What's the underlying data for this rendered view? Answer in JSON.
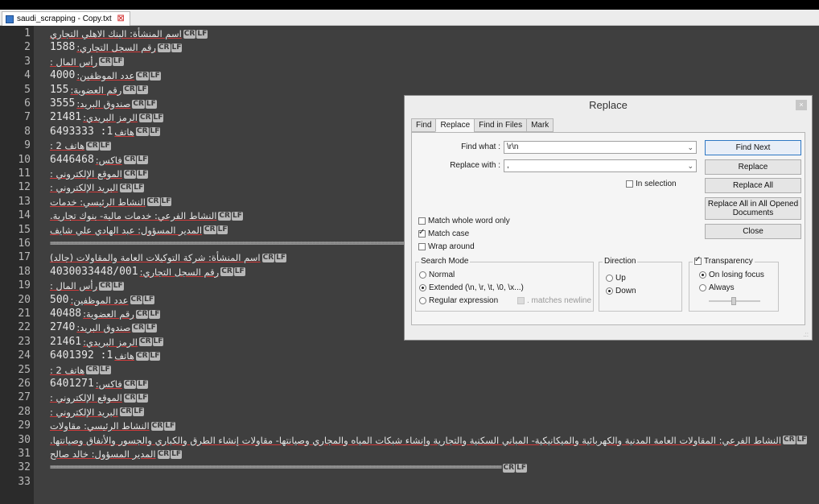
{
  "tab": {
    "filename": "saudi_scrapping - Copy.txt"
  },
  "lines": [
    {
      "num": "1",
      "segs": [
        {
          "t": "ar",
          "v": "اسم المنشأة: البنك الاهلي التجاري"
        },
        {
          "t": "crlf"
        }
      ]
    },
    {
      "num": "2",
      "segs": [
        {
          "t": "num",
          "v": "1588"
        },
        {
          "t": "ar",
          "v": "رقم السجل التجاري:"
        },
        {
          "t": "crlf"
        }
      ]
    },
    {
      "num": "3",
      "segs": [
        {
          "t": "ar",
          "v": "رأس المال :"
        },
        {
          "t": "crlf"
        }
      ]
    },
    {
      "num": "4",
      "segs": [
        {
          "t": "num",
          "v": "4000"
        },
        {
          "t": "ar",
          "v": "عدد الموظفين:"
        },
        {
          "t": "crlf"
        }
      ]
    },
    {
      "num": "5",
      "segs": [
        {
          "t": "num",
          "v": "155"
        },
        {
          "t": "ar",
          "v": "رقم العضوية:"
        },
        {
          "t": "crlf"
        }
      ]
    },
    {
      "num": "6",
      "segs": [
        {
          "t": "num",
          "v": "3555"
        },
        {
          "t": "ar",
          "v": "صندوق البريد:"
        },
        {
          "t": "crlf"
        }
      ]
    },
    {
      "num": "7",
      "segs": [
        {
          "t": "num",
          "v": "21481"
        },
        {
          "t": "ar",
          "v": "الرمز البريدي:"
        },
        {
          "t": "crlf"
        }
      ]
    },
    {
      "num": "8",
      "segs": [
        {
          "t": "num",
          "v": "6493333 :1"
        },
        {
          "t": "ar",
          "v": "هاتف"
        },
        {
          "t": "crlf"
        }
      ]
    },
    {
      "num": "9",
      "segs": [
        {
          "t": "ar",
          "v": "هاتف 2 :"
        },
        {
          "t": "crlf"
        }
      ]
    },
    {
      "num": "10",
      "segs": [
        {
          "t": "num",
          "v": "6446468"
        },
        {
          "t": "ar",
          "v": "فاكس:"
        },
        {
          "t": "crlf"
        }
      ]
    },
    {
      "num": "11",
      "segs": [
        {
          "t": "ar",
          "v": "الموقع الإلكتروني :"
        },
        {
          "t": "crlf"
        }
      ]
    },
    {
      "num": "12",
      "segs": [
        {
          "t": "ar",
          "v": "البريد الإلكتروني :"
        },
        {
          "t": "crlf"
        }
      ]
    },
    {
      "num": "13",
      "segs": [
        {
          "t": "ar",
          "v": "النشاط الرئيسي: خدمات"
        },
        {
          "t": "crlf"
        }
      ]
    },
    {
      "num": "14",
      "segs": [
        {
          "t": "ar",
          "v": "النشاط الفرعي: خدمات مالية- بنوك تجارية."
        },
        {
          "t": "crlf"
        }
      ]
    },
    {
      "num": "15",
      "segs": [
        {
          "t": "ar",
          "v": "المدير المسؤول: عبد الهادي علي شايف"
        },
        {
          "t": "crlf"
        }
      ]
    },
    {
      "num": "16",
      "segs": [
        {
          "t": "eq",
          "v": "============================================================================================================================"
        },
        {
          "t": "crlf"
        }
      ]
    },
    {
      "num": "17",
      "segs": [
        {
          "t": "ar",
          "v": "اسم المنشأة: شركة التوكيلات العامة والمقاولات (جالد)"
        },
        {
          "t": "crlf"
        }
      ]
    },
    {
      "num": "18",
      "segs": [
        {
          "t": "num",
          "v": "4030033448/001"
        },
        {
          "t": "ar",
          "v": "رقم السجل التجاري:"
        },
        {
          "t": "crlf"
        }
      ]
    },
    {
      "num": "19",
      "segs": [
        {
          "t": "ar",
          "v": "رأس المال :"
        },
        {
          "t": "crlf"
        }
      ]
    },
    {
      "num": "20",
      "segs": [
        {
          "t": "num",
          "v": "500"
        },
        {
          "t": "ar",
          "v": "عدد الموظفين:"
        },
        {
          "t": "crlf"
        }
      ]
    },
    {
      "num": "21",
      "segs": [
        {
          "t": "num",
          "v": "40488"
        },
        {
          "t": "ar",
          "v": "رقم العضوية:"
        },
        {
          "t": "crlf"
        }
      ]
    },
    {
      "num": "22",
      "segs": [
        {
          "t": "num",
          "v": "2740"
        },
        {
          "t": "ar",
          "v": "صندوق البريد:"
        },
        {
          "t": "crlf"
        }
      ]
    },
    {
      "num": "23",
      "segs": [
        {
          "t": "num",
          "v": "21461"
        },
        {
          "t": "ar",
          "v": "الرمز البريدي:"
        },
        {
          "t": "crlf"
        }
      ]
    },
    {
      "num": "24",
      "segs": [
        {
          "t": "num",
          "v": "6401392 :1"
        },
        {
          "t": "ar",
          "v": "هاتف"
        },
        {
          "t": "crlf"
        }
      ]
    },
    {
      "num": "25",
      "segs": [
        {
          "t": "ar",
          "v": "هاتف 2 :"
        },
        {
          "t": "crlf"
        }
      ]
    },
    {
      "num": "26",
      "segs": [
        {
          "t": "num",
          "v": "6401271"
        },
        {
          "t": "ar",
          "v": "فاكس:"
        },
        {
          "t": "crlf"
        }
      ]
    },
    {
      "num": "27",
      "segs": [
        {
          "t": "ar",
          "v": "الموقع الإلكتروني :"
        },
        {
          "t": "crlf"
        }
      ]
    },
    {
      "num": "28",
      "segs": [
        {
          "t": "ar",
          "v": "البريد الإلكتروني :"
        },
        {
          "t": "crlf"
        }
      ]
    },
    {
      "num": "29",
      "segs": [
        {
          "t": "ar",
          "v": "النشاط الرئيسي: مقاولات"
        },
        {
          "t": "crlf"
        }
      ]
    },
    {
      "num": "30",
      "segs": [
        {
          "t": "ar",
          "v": "النشاط الفرعي: المقاولات العامة المدنية والكهربائية والميكانيكية- المباني السكنية والتجارية وإنشاء شبكات المياه والمجاري وصيانتها- مقاولات إنشاء الطرق والكباري والجسور والأنفاق وصيانتها."
        },
        {
          "t": "crlf"
        }
      ]
    },
    {
      "num": "31",
      "segs": [
        {
          "t": "ar",
          "v": "المدير المسؤول: خالد صالح"
        },
        {
          "t": "crlf"
        }
      ]
    },
    {
      "num": "32",
      "segs": [
        {
          "t": "eq",
          "v": "============================================================================================================================"
        },
        {
          "t": "crlf"
        }
      ]
    },
    {
      "num": "33",
      "segs": []
    }
  ],
  "crlf": {
    "cr": "CR",
    "lf": "LF"
  },
  "dialog": {
    "title": "Replace",
    "close": "×",
    "tabs": [
      "Find",
      "Replace",
      "Find in Files",
      "Mark"
    ],
    "find_label": "Find what :",
    "find_value": "\\r\\n",
    "replace_label": "Replace with :",
    "replace_value": ",",
    "in_selection": "In selection",
    "buttons": {
      "find_next": "Find Next",
      "replace": "Replace",
      "replace_all": "Replace All",
      "replace_all_docs": "Replace All in All Opened Documents",
      "close": "Close"
    },
    "match_whole_word": "Match whole word only",
    "match_case": "Match case",
    "wrap_around": "Wrap around",
    "search_mode": {
      "title": "Search Mode",
      "normal": "Normal",
      "extended": "Extended (\\n, \\r, \\t, \\0, \\x...)",
      "regex": "Regular expression",
      "matches_newline": ". matches newline"
    },
    "direction": {
      "title": "Direction",
      "up": "Up",
      "down": "Down"
    },
    "transparency": {
      "title": "Transparency",
      "on_losing_focus": "On losing focus",
      "always": "Always"
    },
    "grip": ".::"
  }
}
